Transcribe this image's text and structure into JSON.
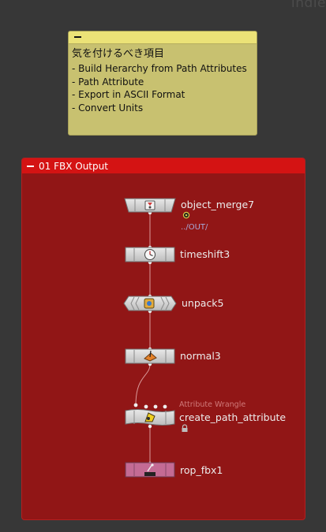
{
  "corner_text": "Indie",
  "sticky_note": {
    "title": "気を付けるべき項目",
    "lines": [
      "- Build Herarchy from Path Attributes",
      "- Path Attribute",
      "- Export in ASCII Format",
      "- Convert Units"
    ]
  },
  "network_box": {
    "title": "01 FBX Output",
    "nodes": [
      {
        "name": "object_merge7",
        "path": "../OUT/",
        "icon": "object-merge-icon"
      },
      {
        "name": "timeshift3",
        "icon": "timeshift-icon"
      },
      {
        "name": "unpack5",
        "icon": "unpack-icon"
      },
      {
        "name": "normal3",
        "icon": "normal-icon"
      },
      {
        "name": "create_path_attribute",
        "type_label": "Attribute Wrangle",
        "icon": "wrangle-icon"
      },
      {
        "name": "rop_fbx1",
        "icon": "rop-fbx-icon"
      }
    ]
  },
  "colors": {
    "background": "#373737",
    "note": "#c8c170",
    "note_header": "#ebe277",
    "netbox": "#911616",
    "netbox_header": "#d41313",
    "rop_node": "#c46b94"
  }
}
